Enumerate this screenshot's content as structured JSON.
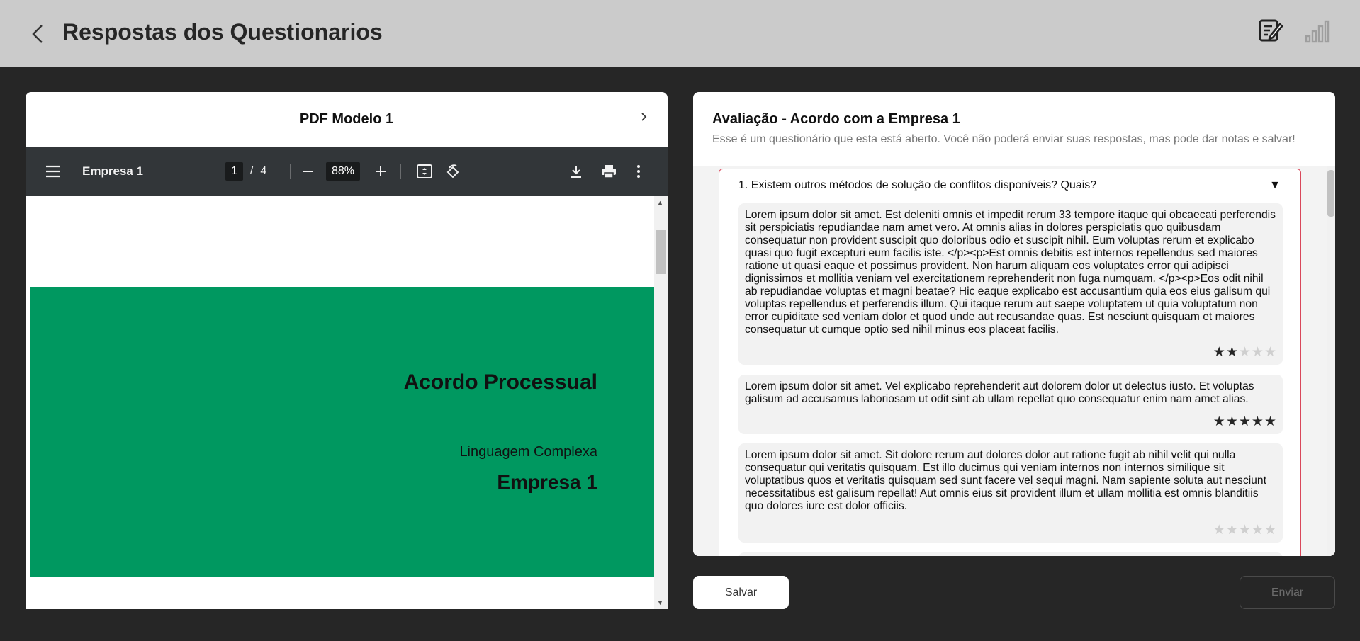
{
  "header": {
    "title": "Respostas dos Questionarios",
    "icons": [
      "back-chevron-icon",
      "edit-document-icon",
      "bar-chart-icon"
    ]
  },
  "pdf": {
    "title": "PDF Modelo 1",
    "viewer": {
      "document_name": "Empresa 1",
      "current_page": "1",
      "page_separator": "/",
      "total_pages": "4",
      "zoom": "88%"
    },
    "page": {
      "heading": "Acordo Processual",
      "subtitle": "Linguagem Complexa",
      "company": "Empresa 1"
    }
  },
  "questionnaire": {
    "title": "Avaliação - Acordo com a Empresa 1",
    "description": "Esse é um questionário que esta está aberto. Você não poderá enviar suas respostas, mas pode dar notas e salvar!",
    "question": "1. Existem outros métodos de solução de conflitos disponíveis? Quais?",
    "toggle": "▼",
    "answers": [
      {
        "text": "Lorem ipsum dolor sit amet. Est deleniti omnis et impedit rerum 33 tempore itaque qui obcaecati perferendis sit perspiciatis repudiandae nam amet vero. At omnis alias in dolores perspiciatis quo quibusdam consequatur non provident suscipit quo doloribus odio et suscipit nihil. Eum voluptas rerum et explicabo quasi quo fugit excepturi eum facilis iste. </p><p>Est omnis debitis est internos repellendus sed maiores ratione ut quasi eaque et possimus provident. Non harum aliquam eos voluptates error qui adipisci dignissimos et mollitia veniam vel exercitationem reprehenderit non fuga numquam. </p><p>Eos odit nihil ab repudiandae voluptas et magni beatae? Hic eaque explicabo est accusantium quia eos eius galisum qui voluptas repellendus et perferendis illum. Qui itaque rerum aut saepe voluptatem ut quia voluptatum non error cupiditate sed veniam dolor et quod unde aut recusandae quas. Est nesciunt quisquam et maiores consequatur ut cumque optio sed nihil minus eos placeat facilis.",
        "rating": 2
      },
      {
        "text": "Lorem ipsum dolor sit amet. Vel explicabo reprehenderit aut dolorem dolor ut delectus iusto. Et voluptas galisum ad accusamus laboriosam ut odit sint ab ullam repellat quo consequatur enim nam amet alias.",
        "rating": 5
      },
      {
        "text": "Lorem ipsum dolor sit amet. Sit dolore rerum aut dolores dolor aut ratione fugit ab nihil velit qui nulla consequatur qui veritatis quisquam. Est illo ducimus qui veniam internos non internos similique sit voluptatibus quos et veritatis quisquam sed sunt facere vel sequi magni. Nam sapiente soluta aut nesciunt necessitatibus est galisum repellat! Aut omnis eius sit provident illum et ullam mollitia est omnis blanditiis quo dolores iure est dolor officiis.",
        "rating": 0
      }
    ],
    "max_rating": 5
  },
  "actions": {
    "save_label": "Salvar",
    "send_label": "Enviar"
  },
  "colors": {
    "header_bg": "#cbcbcb",
    "page_bg": "#262626",
    "pdf_band": "#009860",
    "card_border": "#d9475a"
  }
}
